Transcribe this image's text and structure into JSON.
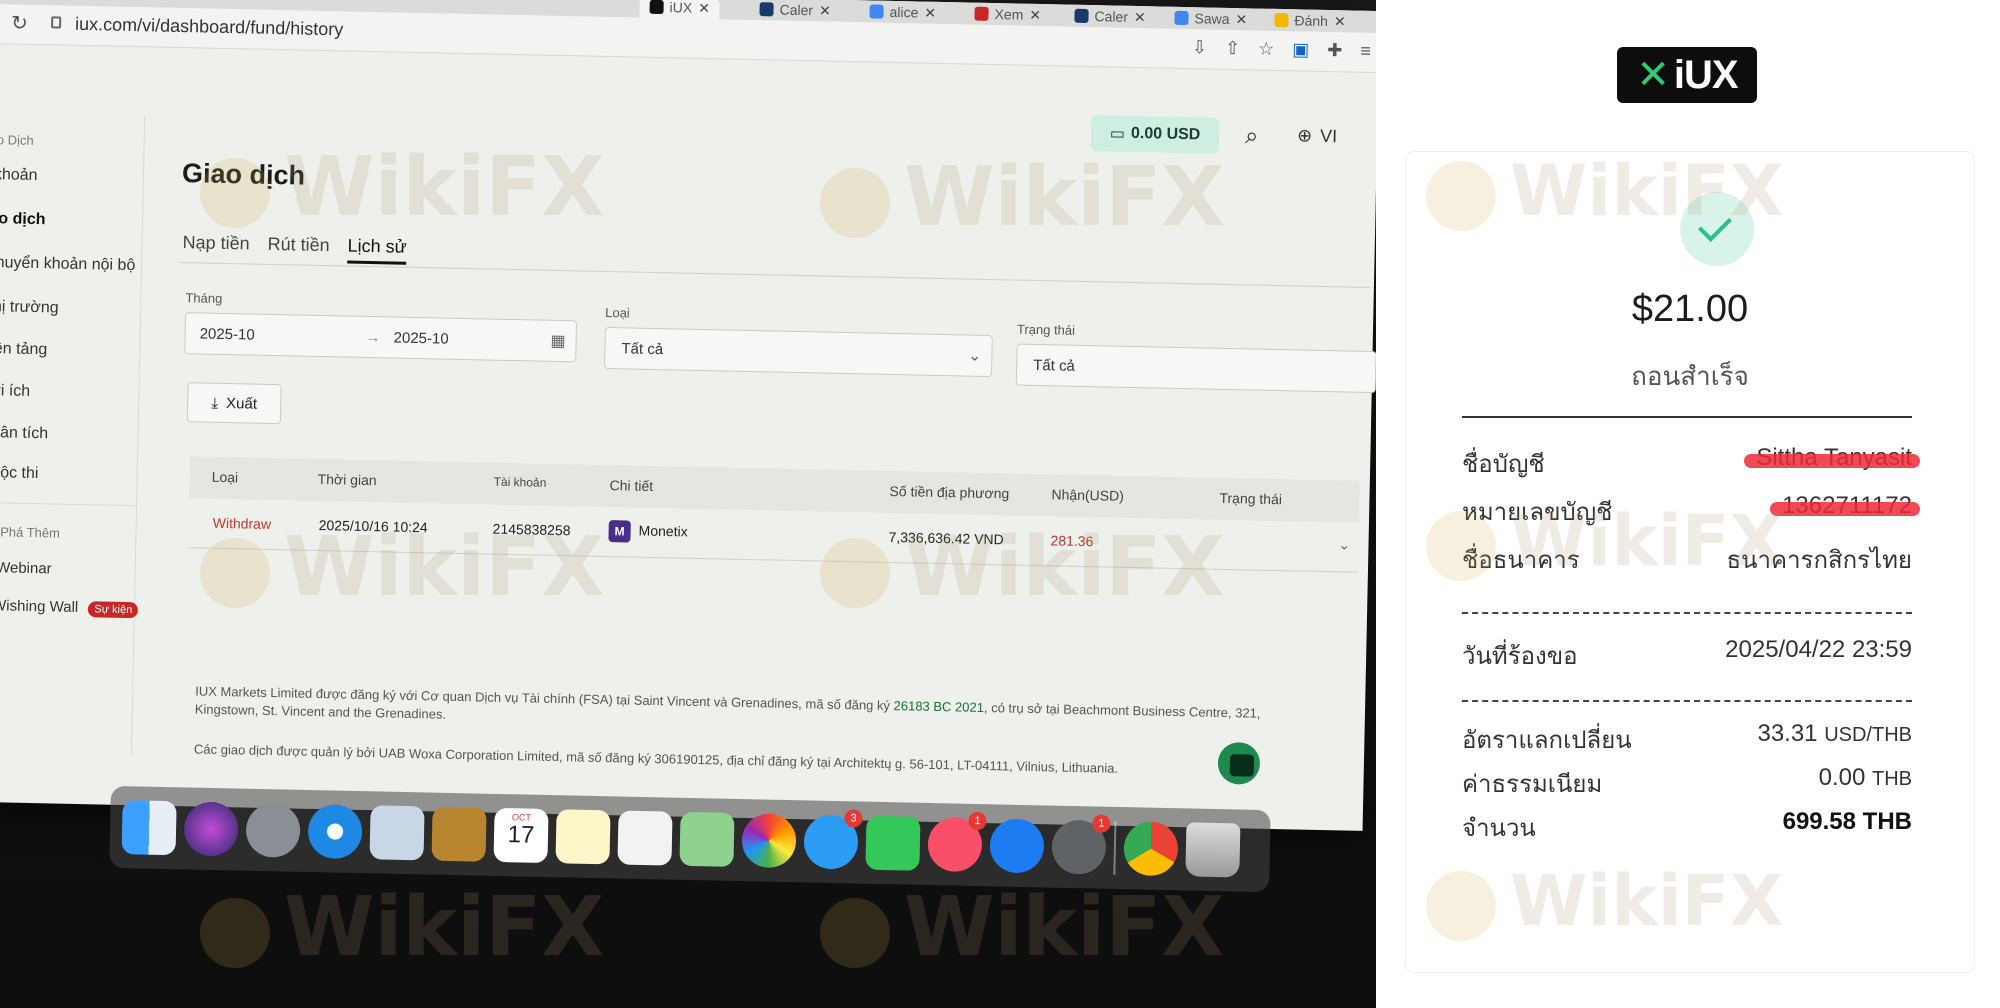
{
  "browser": {
    "tabs": [
      {
        "label": "Caler",
        "color": "#1a3a6b"
      },
      {
        "label": "alice",
        "color": "#4285f4"
      },
      {
        "label": "Xem",
        "color": "#c62828"
      },
      {
        "label": "Caler",
        "color": "#1a3a6b"
      },
      {
        "label": "Sawa",
        "color": "#4285f4"
      },
      {
        "label": "Đánh",
        "color": "#f2b705"
      }
    ],
    "active_tab_label": "iUX",
    "url": "iux.com/vi/dashboard/fund/history"
  },
  "header": {
    "balance": "0.00 USD",
    "language": "VI"
  },
  "sidebar": {
    "section1": "iao Dịch",
    "items": [
      "i khoản",
      "iao dịch",
      "Chuyển khoản nội bộ",
      "Thị trường",
      "Nền tảng",
      "Lợi ích",
      "Phân tích",
      "Cuộc thi"
    ],
    "section2": "âm Phá Thêm",
    "extra_items": [
      "Webinar",
      "Wishing Wall"
    ],
    "event_badge": "Sự kiện"
  },
  "main": {
    "title": "Giao dịch",
    "tabs": [
      "Nạp tiền",
      "Rút tiền",
      "Lịch sử"
    ],
    "filters": {
      "month_label": "Tháng",
      "month_from": "2025-10",
      "month_to": "2025-10",
      "type_label": "Loại",
      "type_value": "Tất cả",
      "status_label": "Trạng thái",
      "status_value": "Tất cả"
    },
    "export_label": "Xuất",
    "table": {
      "headers": [
        "Loại",
        "Thời gian",
        "Tài khoản",
        "Chi tiết",
        "Số tiền địa phương",
        "Nhận(USD)",
        "Trạng thái"
      ],
      "row": {
        "type": "Withdraw",
        "time": "2025/10/16 10:24",
        "account": "2145838258",
        "detail": "Monetix",
        "local_amount": "7,336,636.42 VND",
        "received": "281.36"
      }
    },
    "footer": {
      "line1a": "IUX Markets Limited được đăng ký với Cơ quan Dịch vụ Tài chính (FSA) tại Saint Vincent và Grenadines, mã số đăng ký ",
      "line1_link": "26183 BC 2021",
      "line1b": ", có trụ sở tại Beachmont Business Centre, 321, Kingstown, St. Vincent and the Grenadines.",
      "line2": "Các giao dịch được quản lý bởi UAB Woxa Corporation Limited, mã số đăng ký 306190125, địa chỉ đăng ký tại Architektų g. 56-101, LT-04111, Vilnius, Lithuania."
    }
  },
  "dock": {
    "calendar_month": "OCT",
    "calendar_day": "17",
    "badges": {
      "messages": "3",
      "music": "1",
      "settings": "1"
    }
  },
  "receipt": {
    "logo_text": "iUX",
    "amount": "$21.00",
    "status": "ถอนสำเร็จ",
    "rows": [
      {
        "label": "ชื่อบัญชี",
        "value": "Sittha Tanyasit"
      },
      {
        "label": "หมายเลขบัญชี",
        "value": "1362711172"
      },
      {
        "label": "ชื่อธนาคาร",
        "value": "ธนาคารกสิกรไทย"
      }
    ],
    "date_label": "วันที่ร้องขอ",
    "date_value": "2025/04/22 23:59",
    "rate_label": "อัตราแลกเปลี่ยน",
    "rate_value": "33.31",
    "rate_unit": "USD/THB",
    "fee_label": "ค่าธรรมเนียม",
    "fee_value": "0.00",
    "fee_unit": "THB",
    "total_label": "จำนวน",
    "total_value": "699.58 THB"
  },
  "watermark": "WikiFX",
  "colors": {
    "accent_green": "#2bbf8a",
    "withdraw_red": "#c0392b",
    "brand_dark": "#0d0d0d"
  }
}
